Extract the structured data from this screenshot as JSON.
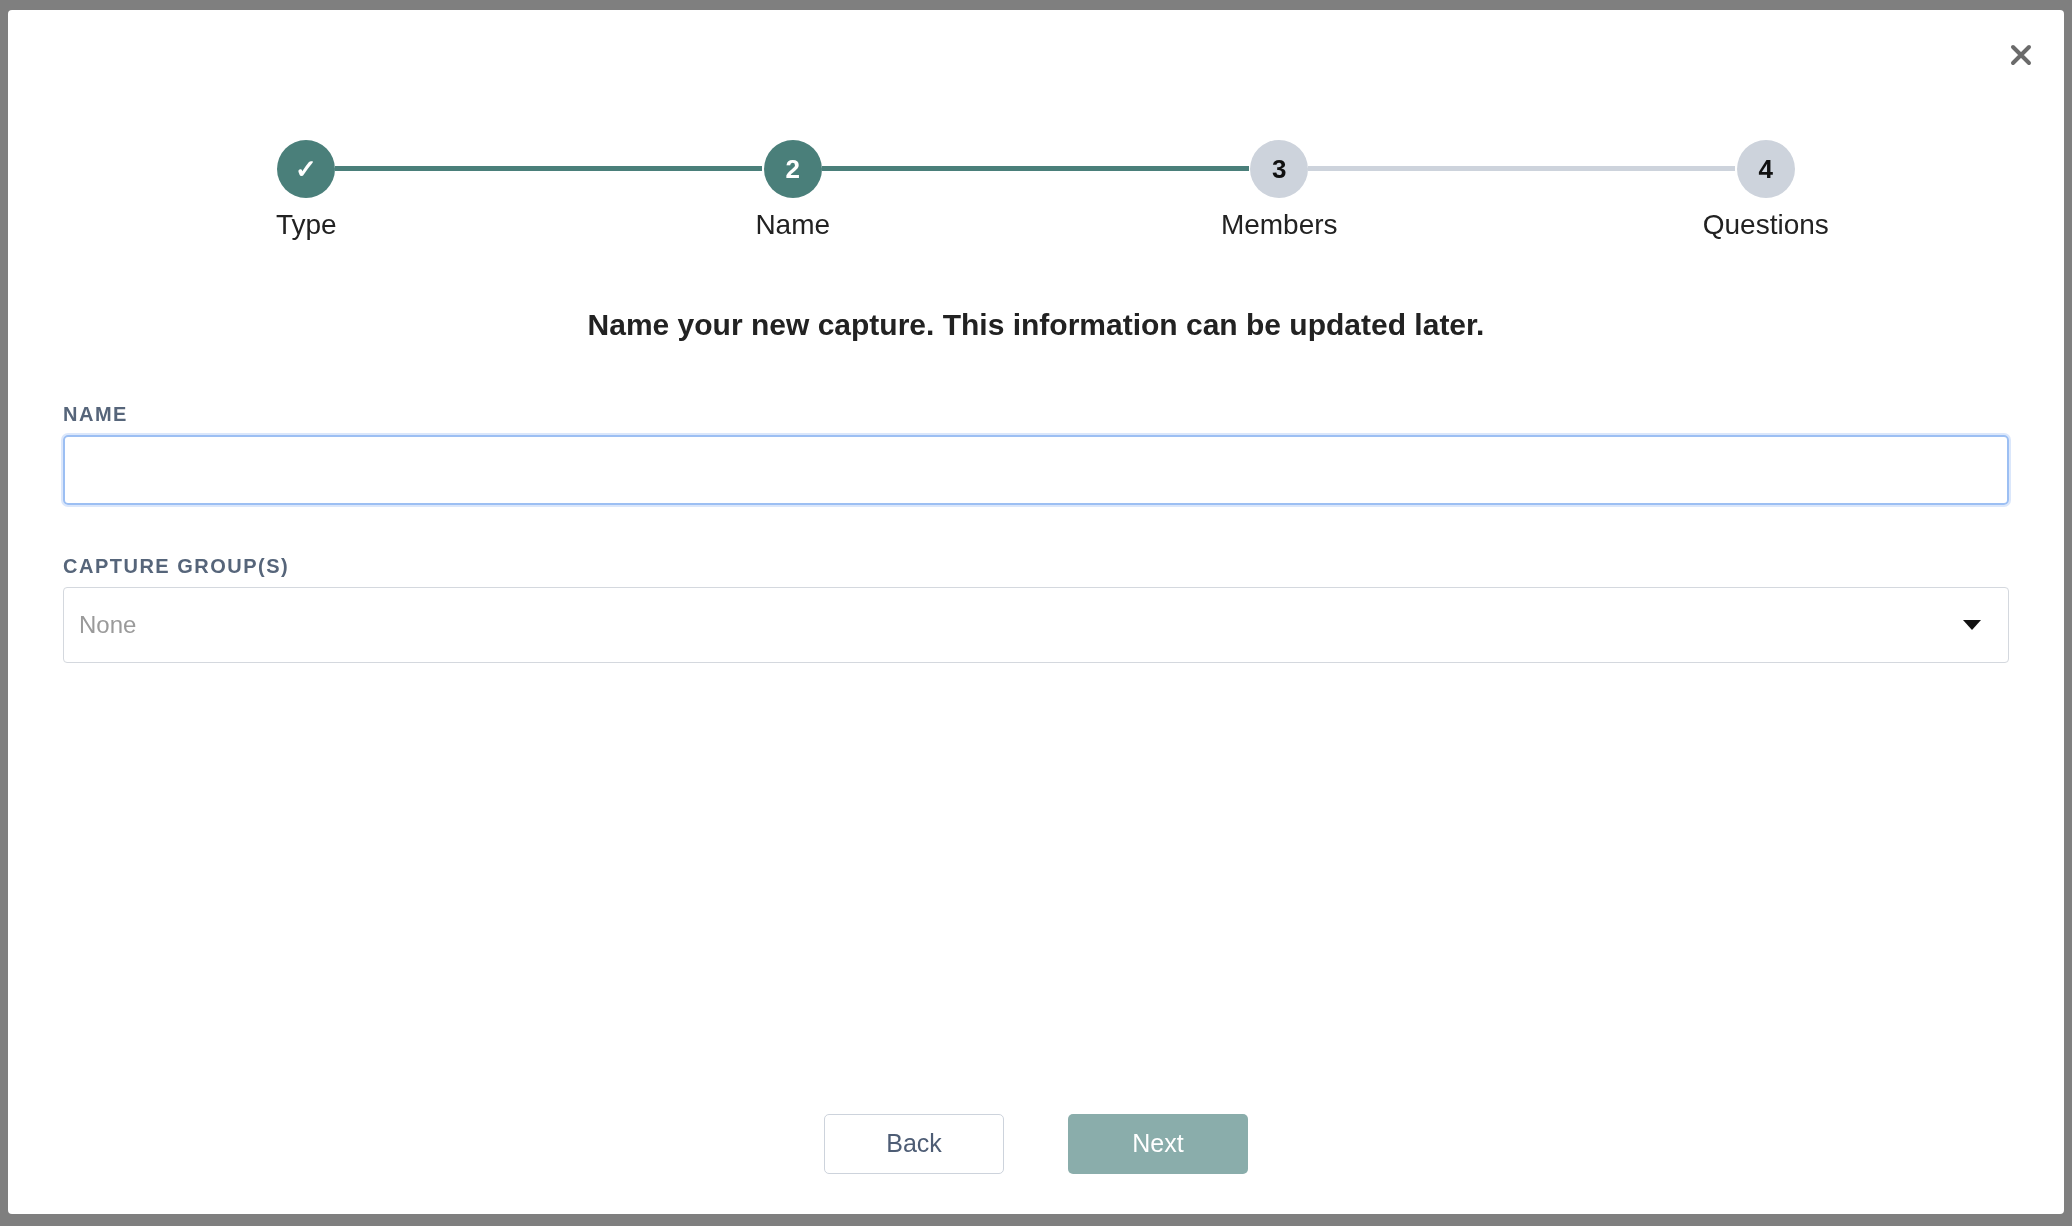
{
  "steps": [
    {
      "number": "✓",
      "label": "Type",
      "kind": "done"
    },
    {
      "number": "2",
      "label": "Name",
      "kind": "current"
    },
    {
      "number": "3",
      "label": "Members",
      "kind": "upcoming"
    },
    {
      "number": "4",
      "label": "Questions",
      "kind": "upcoming"
    }
  ],
  "heading": "Name your new capture. This information can be updated later.",
  "fields": [
    {
      "label": "NAME",
      "kind": "text",
      "focused": true
    },
    {
      "label": "CAPTURE GROUP(S)",
      "kind": "select",
      "placeholder": "None"
    }
  ],
  "buttons": [
    {
      "label": "Back",
      "kind": "secondary",
      "disabled": false
    },
    {
      "label": "Next",
      "kind": "primary",
      "disabled": true
    }
  ]
}
